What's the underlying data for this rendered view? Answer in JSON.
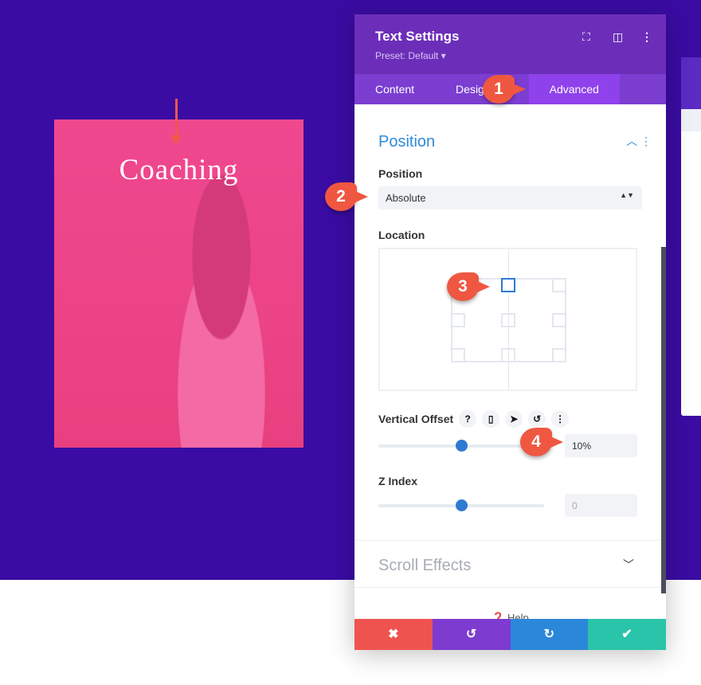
{
  "canvas": {
    "card_title": "Coaching"
  },
  "panel": {
    "title": "Text Settings",
    "preset": "Preset: Default ▾",
    "icons": [
      "focus-icon",
      "split-view-icon",
      "more-vert-icon"
    ],
    "tabs": [
      {
        "label": "Content"
      },
      {
        "label": "Design"
      },
      {
        "label": "Advanced",
        "active": true
      }
    ],
    "section": "Position",
    "position_label": "Position",
    "position_value": "Absolute",
    "location_label": "Location",
    "location_selected": "top-center",
    "vertical_offset_label": "Vertical Offset",
    "vertical_offset_value": "10%",
    "vertical_offset_slider": 0.5,
    "z_index_label": "Z Index",
    "z_index_value": "0",
    "z_index_slider": 0.5,
    "scroll_effects": "Scroll Effects",
    "help": "Help",
    "footer": {
      "cancel": "✖",
      "undo": "↺",
      "redo": "↻",
      "save": "✔"
    }
  },
  "badges": [
    "1",
    "2",
    "3",
    "4"
  ],
  "colors": {
    "background": "#3a0ca3",
    "header": "#6c2eb9",
    "accent": "#2e8bd8",
    "cancel": "#ef5350",
    "undo": "#7d3bcf",
    "redo": "#2b87da",
    "save": "#29c4a9"
  }
}
